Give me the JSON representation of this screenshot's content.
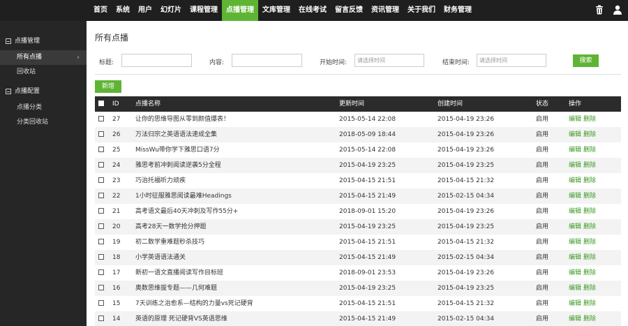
{
  "nav": {
    "items": [
      "首页",
      "系统",
      "用户",
      "幻灯片",
      "课程管理",
      "点播管理",
      "文库管理",
      "在线考试",
      "留言反馈",
      "资讯管理",
      "关于我们",
      "财务管理"
    ],
    "active_index": 5
  },
  "colors": {
    "accent": "#5fb434",
    "topbar": "#1f1f1f",
    "sidebar": "#262626"
  },
  "sidebar": {
    "groups": [
      {
        "label": "点播管理",
        "items": [
          "所有点播",
          "回收站"
        ]
      },
      {
        "label": "点播配置",
        "items": [
          "点播分类",
          "分类回收站"
        ]
      }
    ],
    "active_item": "所有点播"
  },
  "main": {
    "title": "所有点播",
    "filter": {
      "title_label": "标题:",
      "content_label": "内容:",
      "start_label": "开始时间:",
      "start_placeholder": "请选择时间",
      "end_label": "结束时间:",
      "end_placeholder": "请选择时间",
      "search_label": "搜索"
    },
    "add_label": "新增",
    "table": {
      "headers": {
        "id": "ID",
        "name": "点播名称",
        "updated": "更新时间",
        "created": "创建时间",
        "status": "状态",
        "ops": "操作"
      },
      "edit_label": "编辑",
      "delete_label": "删除",
      "rows": [
        {
          "id": "27",
          "name": "让你的思维导图从零到颜值爆表！",
          "updated": "2015-05-14 22:08",
          "created": "2015-04-19 23:26",
          "status": "启用"
        },
        {
          "id": "26",
          "name": "万法归宗之英语语法速成全集",
          "updated": "2018-05-09 18:44",
          "created": "2015-04-19 23:26",
          "status": "启用"
        },
        {
          "id": "25",
          "name": "MissWu带你学下雅思口语7分",
          "updated": "2015-05-14 22:08",
          "created": "2015-04-19 23:26",
          "status": "启用"
        },
        {
          "id": "24",
          "name": "雅思考前冲刺阅读逆袭5分全程",
          "updated": "2015-04-19 23:25",
          "created": "2015-04-19 23:25",
          "status": "启用"
        },
        {
          "id": "23",
          "name": "巧治托福听力顽疾",
          "updated": "2015-04-15 21:51",
          "created": "2015-04-15 21:32",
          "status": "启用"
        },
        {
          "id": "22",
          "name": "1小时征服雅思阅读最难Headings",
          "updated": "2015-04-15 21:49",
          "created": "2015-02-15 04:34",
          "status": "启用"
        },
        {
          "id": "21",
          "name": "高考语文最后40天冲刺及写作55分+",
          "updated": "2018-09-01 15:20",
          "created": "2015-04-19 23:26",
          "status": "启用"
        },
        {
          "id": "20",
          "name": "高考28天一数学抢分押题",
          "updated": "2015-04-19 23:25",
          "created": "2015-04-19 23:25",
          "status": "启用"
        },
        {
          "id": "19",
          "name": "初二数学重难题秒杀技巧",
          "updated": "2015-04-15 21:51",
          "created": "2015-04-15 21:32",
          "status": "启用"
        },
        {
          "id": "18",
          "name": "小学英语语法通关",
          "updated": "2015-04-15 21:49",
          "created": "2015-02-15 04:34",
          "status": "启用"
        },
        {
          "id": "17",
          "name": "新初一语文直播阅读写作目标班",
          "updated": "2018-09-01 23:53",
          "created": "2015-04-19 23:26",
          "status": "启用"
        },
        {
          "id": "16",
          "name": "奥数思维拔专题——几何难题",
          "updated": "2015-04-19 23:25",
          "created": "2015-04-19 23:25",
          "status": "启用"
        },
        {
          "id": "15",
          "name": "7天训练之治愈系—结构的力量vs死记硬背",
          "updated": "2015-04-15 21:51",
          "created": "2015-04-15 21:32",
          "status": "启用"
        },
        {
          "id": "14",
          "name": "英语的原理 死记硬背VS英语思维",
          "updated": "2015-04-15 21:49",
          "created": "2015-02-15 04:34",
          "status": "启用"
        }
      ]
    }
  },
  "icons": {
    "trash": "trash-icon",
    "user": "user-icon"
  }
}
